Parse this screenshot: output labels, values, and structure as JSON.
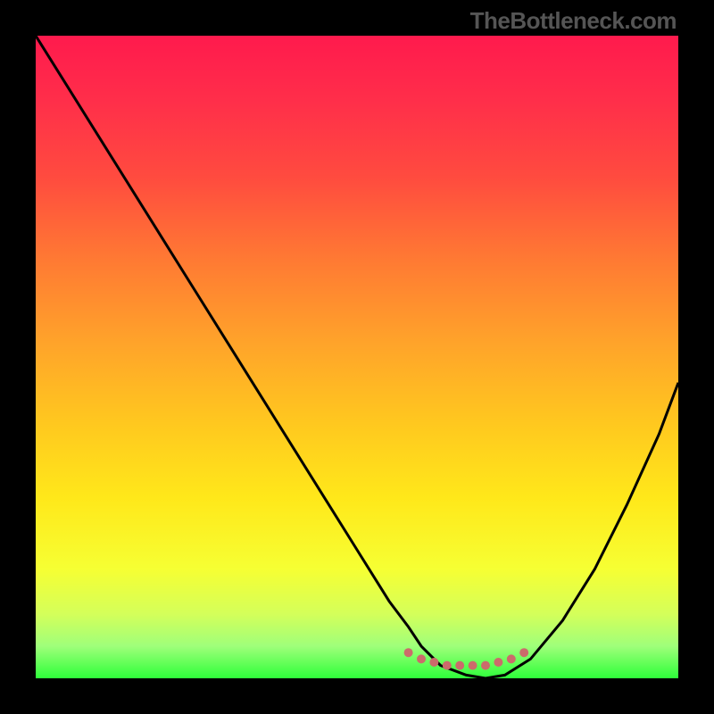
{
  "watermark": "TheBottleneck.com",
  "gradient_stops": [
    {
      "offset": 0.0,
      "color": "#ff1a4d"
    },
    {
      "offset": 0.1,
      "color": "#ff2e4a"
    },
    {
      "offset": 0.22,
      "color": "#ff4b3f"
    },
    {
      "offset": 0.35,
      "color": "#ff7a33"
    },
    {
      "offset": 0.48,
      "color": "#ffa42a"
    },
    {
      "offset": 0.6,
      "color": "#ffc71f"
    },
    {
      "offset": 0.72,
      "color": "#ffe81a"
    },
    {
      "offset": 0.83,
      "color": "#f6ff33"
    },
    {
      "offset": 0.9,
      "color": "#d4ff5a"
    },
    {
      "offset": 0.95,
      "color": "#9fff7a"
    },
    {
      "offset": 1.0,
      "color": "#2eff3a"
    }
  ],
  "chart_data": {
    "type": "line",
    "title": "",
    "xlabel": "",
    "ylabel": "",
    "xlim": [
      0,
      100
    ],
    "ylim": [
      0,
      100
    ],
    "series": [
      {
        "name": "bottleneck-curve",
        "color": "#000000",
        "stroke_width": 3,
        "x": [
          0,
          5,
          10,
          15,
          20,
          25,
          30,
          35,
          40,
          45,
          50,
          55,
          58,
          60,
          63,
          67,
          70,
          73,
          77,
          82,
          87,
          92,
          97,
          100
        ],
        "y": [
          100,
          92,
          84,
          76,
          68,
          60,
          52,
          44,
          36,
          28,
          20,
          12,
          8,
          5,
          2,
          0.5,
          0,
          0.5,
          3,
          9,
          17,
          27,
          38,
          46
        ]
      },
      {
        "name": "bottom-dots",
        "color": "#cc6b6b",
        "type": "scatter",
        "marker_size": 10,
        "x": [
          58,
          60,
          62,
          64,
          66,
          68,
          70,
          72,
          74,
          76
        ],
        "y": [
          4,
          3,
          2.5,
          2,
          2,
          2,
          2,
          2.5,
          3,
          4
        ]
      }
    ]
  }
}
